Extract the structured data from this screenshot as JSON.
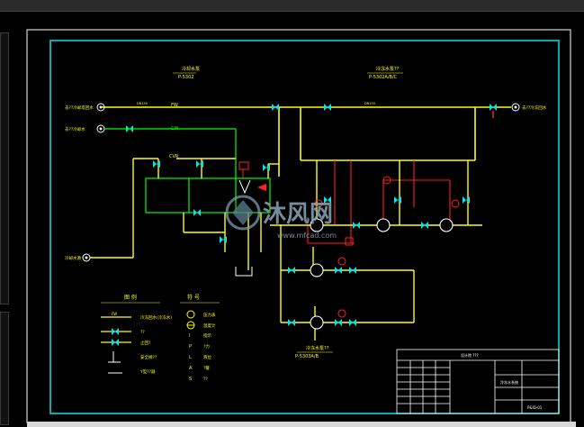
{
  "labels": {
    "title_left_top": "冷却水泵",
    "title_left_sub": "P-5302",
    "title_right_top": "冷冻水泵??",
    "title_right_sub": "P-5302A/B/C",
    "inlet_1": "去??冷却塔回水",
    "inlet_2": "去??冷却水",
    "outlet_right": "去??冷冻回水",
    "bottom_left": "冷却水源",
    "pump_group_title": "冷冻水泵??",
    "pump_group_sub": "P-5303A/B",
    "pipe_fw": "FW",
    "pipe_cw": "CW",
    "cvr": "CVR",
    "dn_label": "DN150"
  },
  "watermark": {
    "text": "沐风网",
    "url": "www.mfcad.com"
  },
  "legend": {
    "heading_a": "图 例",
    "heading_b": "符 号",
    "rows": [
      {
        "line": "FW",
        "text": "冷冻回水(冷冻水)"
      },
      {
        "line": "CW",
        "text": "??"
      },
      {
        "line": "",
        "text": "止回?"
      },
      {
        "line": "",
        "text": "安全阀??"
      },
      {
        "line": "Y",
        "text": "Y型??器"
      }
    ],
    "symbols": [
      {
        "sym": "○",
        "text": "压力表"
      },
      {
        "sym": "⊖",
        "text": "温度计"
      },
      {
        "sym": "I",
        "text": "指示"
      },
      {
        "sym": "P",
        "text": "?力"
      },
      {
        "sym": "L",
        "text": "液位"
      },
      {
        "sym": "A",
        "text": "?警"
      },
      {
        "sym": "S",
        "text": "??"
      }
    ]
  },
  "title_block": {
    "company": "设计院 ???",
    "drawing_title": "冷冻水系统",
    "drawing_no": "P&ID-01"
  },
  "colors": {
    "frame": "#00e5ee",
    "pipe_main": "#ffff00",
    "pipe_cw": "#00ff00",
    "pipe_red": "#ff2020",
    "text": "#ffff00",
    "white": "#ffffff"
  }
}
